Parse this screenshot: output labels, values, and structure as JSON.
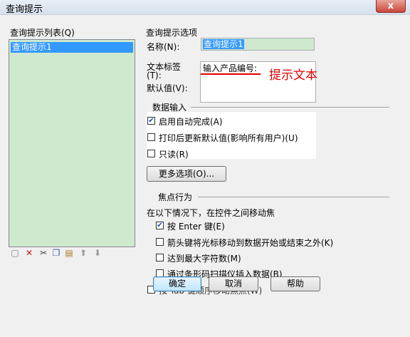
{
  "window": {
    "title": "查询提示",
    "close_glyph": "x"
  },
  "list": {
    "label": "查询提示列表(Q)",
    "items": [
      "查询提示1"
    ]
  },
  "options": {
    "header": "查询提示选项",
    "name_label": "名称(N):",
    "name_value": "查询提示1",
    "prompt_label_line1": "文本标签",
    "prompt_label_line2": "(T):",
    "default_label": "默认值(V):",
    "prompt_value": "输入产品编号:",
    "annotation": "提示文本"
  },
  "data_input": {
    "header": "数据输入",
    "autocomplete": {
      "label": "启用自动完成(A)",
      "checked": true
    },
    "refresh_default": {
      "label": "打印后更新默认值(影响所有用户)(U)",
      "checked": false
    },
    "readonly": {
      "label": "只读(R)",
      "checked": false
    },
    "more_options": "更多选项(O)..."
  },
  "focus": {
    "header": "焦点行为",
    "intro": "在以下情况下，在控件之间移动焦",
    "enter": {
      "label": "按 Enter 键(E)",
      "checked": true
    },
    "arrow": {
      "label": "箭头键将光标移动到数据开始或结束之外(K)",
      "checked": false
    },
    "maxchars": {
      "label": "达到最大字符数(M)",
      "checked": false
    },
    "barcode": {
      "label": "通过条形码扫描仪插入数据(B)",
      "checked": false
    },
    "tab_partial": "按 Tab 键顺序移动焦点(W)"
  },
  "buttons": {
    "ok": "确定",
    "cancel": "取消",
    "help": "帮助"
  },
  "colors": {
    "accent": "#3399ff",
    "list_bg": "#cfe9cf",
    "annotation": "#e00000"
  }
}
